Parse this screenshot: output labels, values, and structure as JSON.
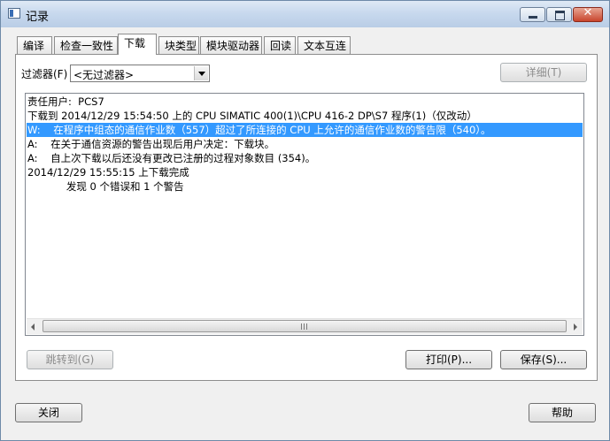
{
  "window": {
    "title": "记录",
    "close_glyph": "✕"
  },
  "tabs": [
    {
      "label": "编译",
      "active": false
    },
    {
      "label": "检查一致性",
      "active": false
    },
    {
      "label": "下载",
      "active": true
    },
    {
      "label": "块类型",
      "active": false
    },
    {
      "label": "模块驱动器",
      "active": false
    },
    {
      "label": "回读",
      "active": false
    },
    {
      "label": "文本互连",
      "active": false
    }
  ],
  "filter": {
    "label": "过滤器(F)",
    "value": "<无过滤器>"
  },
  "details_button": "详细(T)",
  "log": {
    "lines": [
      "责任用户:  PCS7",
      "下载到 2014/12/29 15:54:50 上的 CPU SIMATIC 400(1)\\CPU 416-2 DP\\S7 程序(1)（仅改动）",
      "W:    在程序中组态的通信作业数（557）超过了所连接的 CPU 上允许的通信作业数的警告限（540）。",
      "A:    在关于通信资源的警告出现后用户决定：下载块。",
      "A:    自上次下载以后还没有更改已注册的过程对象数目 (354)。",
      "2014/12/29 15:55:15 上下载完成",
      "            发现 0 个错误和 1 个警告"
    ],
    "selected_index": 2
  },
  "buttons": {
    "goto": "跳转到(G)",
    "print": "打印(P)...",
    "save": "保存(S)...",
    "close": "关闭",
    "help": "帮助"
  }
}
